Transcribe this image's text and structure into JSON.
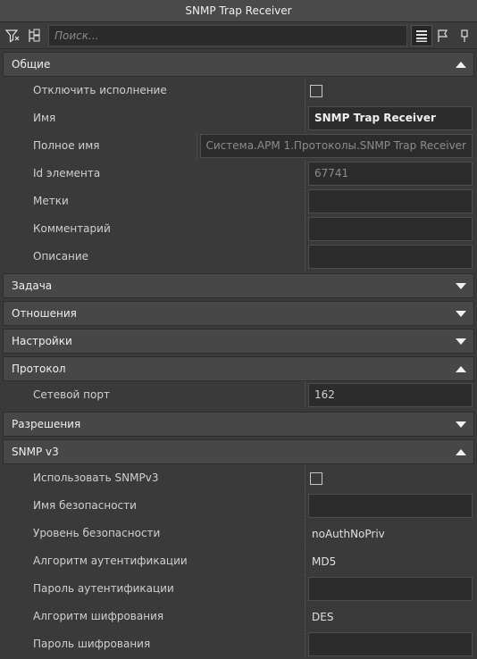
{
  "window": {
    "title": "SNMP Trap Receiver"
  },
  "toolbar": {
    "search_placeholder": "Поиск..."
  },
  "sections": {
    "general": {
      "title": "Общие",
      "rows": {
        "disable": {
          "label": "Отключить исполнение",
          "checked": false
        },
        "name": {
          "label": "Имя",
          "value": "SNMP Trap Receiver"
        },
        "fullname": {
          "label": "Полное имя",
          "value": "Система.АРМ 1.Протоколы.SNMP Trap Receiver"
        },
        "id": {
          "label": "Id элемента",
          "value": "67741"
        },
        "tags": {
          "label": "Метки",
          "value": ""
        },
        "comment": {
          "label": "Комментарий",
          "value": ""
        },
        "description": {
          "label": "Описание",
          "value": ""
        }
      }
    },
    "task": {
      "title": "Задача"
    },
    "relations": {
      "title": "Отношения"
    },
    "settings": {
      "title": "Настройки"
    },
    "protocol": {
      "title": "Протокол",
      "rows": {
        "port": {
          "label": "Сетевой порт",
          "value": "162"
        }
      }
    },
    "permissions": {
      "title": "Разрешения"
    },
    "snmpv3": {
      "title": "SNMP v3",
      "rows": {
        "use": {
          "label": "Использовать SNMPv3",
          "checked": false
        },
        "secname": {
          "label": "Имя безопасности",
          "value": ""
        },
        "seclevel": {
          "label": "Уровень безопасности",
          "value": "noAuthNoPriv"
        },
        "authalg": {
          "label": "Алгоритм аутентификации",
          "value": "MD5"
        },
        "authpass": {
          "label": "Пароль аутентификации",
          "value": ""
        },
        "encalg": {
          "label": "Алгоритм шифрования",
          "value": "DES"
        },
        "encpass": {
          "label": "Пароль шифрования",
          "value": ""
        }
      }
    }
  }
}
